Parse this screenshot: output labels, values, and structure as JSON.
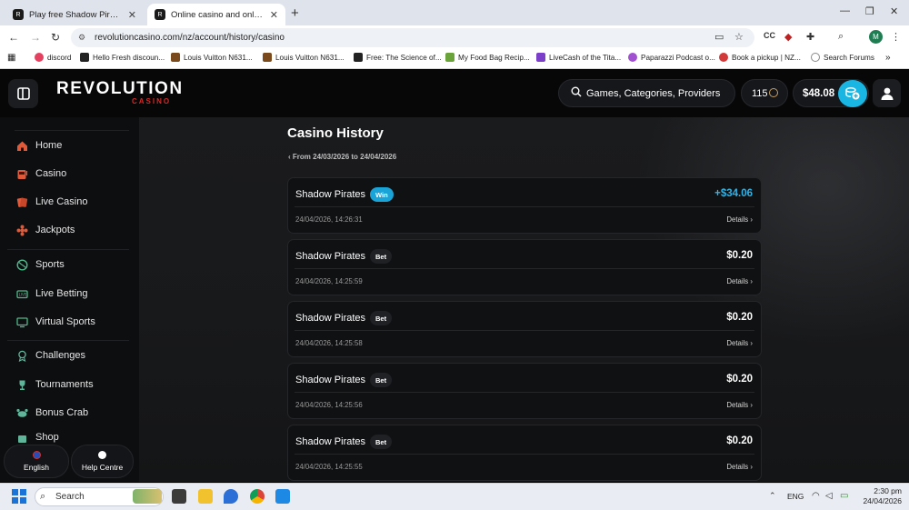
{
  "browser": {
    "tabs": [
      {
        "title": "Play free Shadow Pirates for high"
      },
      {
        "title": "Online casino and online betting"
      }
    ],
    "url": "revolutioncasino.com/nz/account/history/casino",
    "bookmarks": [
      {
        "label": "discord"
      },
      {
        "label": "Hello Fresh discoun..."
      },
      {
        "label": "Louis Vuitton N631..."
      },
      {
        "label": "Louis Vuitton N631..."
      },
      {
        "label": "Free: The Science of..."
      },
      {
        "label": "My Food Bag Recip..."
      },
      {
        "label": "LiveCash of the Tita..."
      },
      {
        "label": "Paparazzi Podcast o..."
      },
      {
        "label": "Book a pickup | NZ..."
      },
      {
        "label": "Search Forums"
      }
    ],
    "profile_initial": "M"
  },
  "header": {
    "logo": "REVOLUTION",
    "logo_sub": "CASINO",
    "search_label": "Games, Categories, Providers",
    "points": "115",
    "balance": "$48.08"
  },
  "sidebar": {
    "items": [
      {
        "label": "Home"
      },
      {
        "label": "Casino"
      },
      {
        "label": "Live Casino"
      },
      {
        "label": "Jackpots"
      },
      {
        "label": "Sports"
      },
      {
        "label": "Live Betting"
      },
      {
        "label": "Virtual Sports"
      },
      {
        "label": "Challenges"
      },
      {
        "label": "Tournaments"
      },
      {
        "label": "Bonus Crab"
      },
      {
        "label": "Shop"
      }
    ],
    "language_label": "English",
    "help_label": "Help Centre"
  },
  "main": {
    "title": "Casino History",
    "date_range": "From 24/03/2026 to 24/04/2026",
    "details_label": "Details",
    "transactions": [
      {
        "game": "Shadow Pirates",
        "type": "Win",
        "amount": "+$34.06",
        "time": "24/04/2026, 14:26:31"
      },
      {
        "game": "Shadow Pirates",
        "type": "Bet",
        "amount": "$0.20",
        "time": "24/04/2026, 14:25:59"
      },
      {
        "game": "Shadow Pirates",
        "type": "Bet",
        "amount": "$0.20",
        "time": "24/04/2026, 14:25:58"
      },
      {
        "game": "Shadow Pirates",
        "type": "Bet",
        "amount": "$0.20",
        "time": "24/04/2026, 14:25:56"
      },
      {
        "game": "Shadow Pirates",
        "type": "Bet",
        "amount": "$0.20",
        "time": "24/04/2026, 14:25:55"
      }
    ]
  },
  "taskbar": {
    "search_label": "Search",
    "language": "ENG",
    "time": "2:30 pm",
    "date": "24/04/2026"
  },
  "colors": {
    "accent": "#19b6e4",
    "win_amount": "#31b3e6",
    "brand_red": "#d22a2a"
  }
}
